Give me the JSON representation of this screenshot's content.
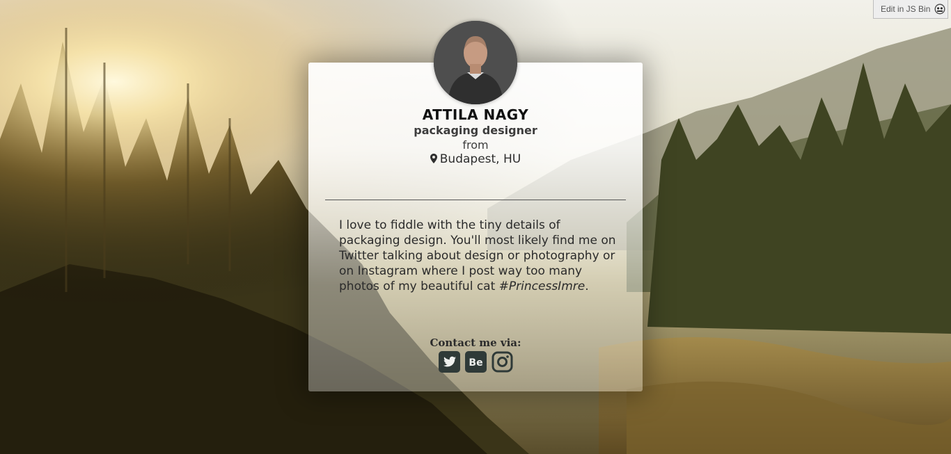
{
  "toolbar": {
    "edit_label": "Edit in JS Bin"
  },
  "profile": {
    "name": "ATTILA NAGY",
    "role": "packaging designer",
    "from_label": "from",
    "location": "Budapest, HU"
  },
  "bio": {
    "text_before": "I love to fiddle with the tiny details of packaging design. You'll most likely find me on Twitter talking about design or photography or on Instagram where I post way too many photos of my beautiful cat ",
    "hashtag": "#PrincessImre",
    "text_after": "."
  },
  "contact": {
    "label": "Contact me via:",
    "links": [
      {
        "icon": "twitter-icon"
      },
      {
        "icon": "behance-icon"
      },
      {
        "icon": "instagram-icon"
      }
    ]
  },
  "colors": {
    "icon": "#2f3a38",
    "card": "#ffffff",
    "text": "#2b2b2b"
  }
}
